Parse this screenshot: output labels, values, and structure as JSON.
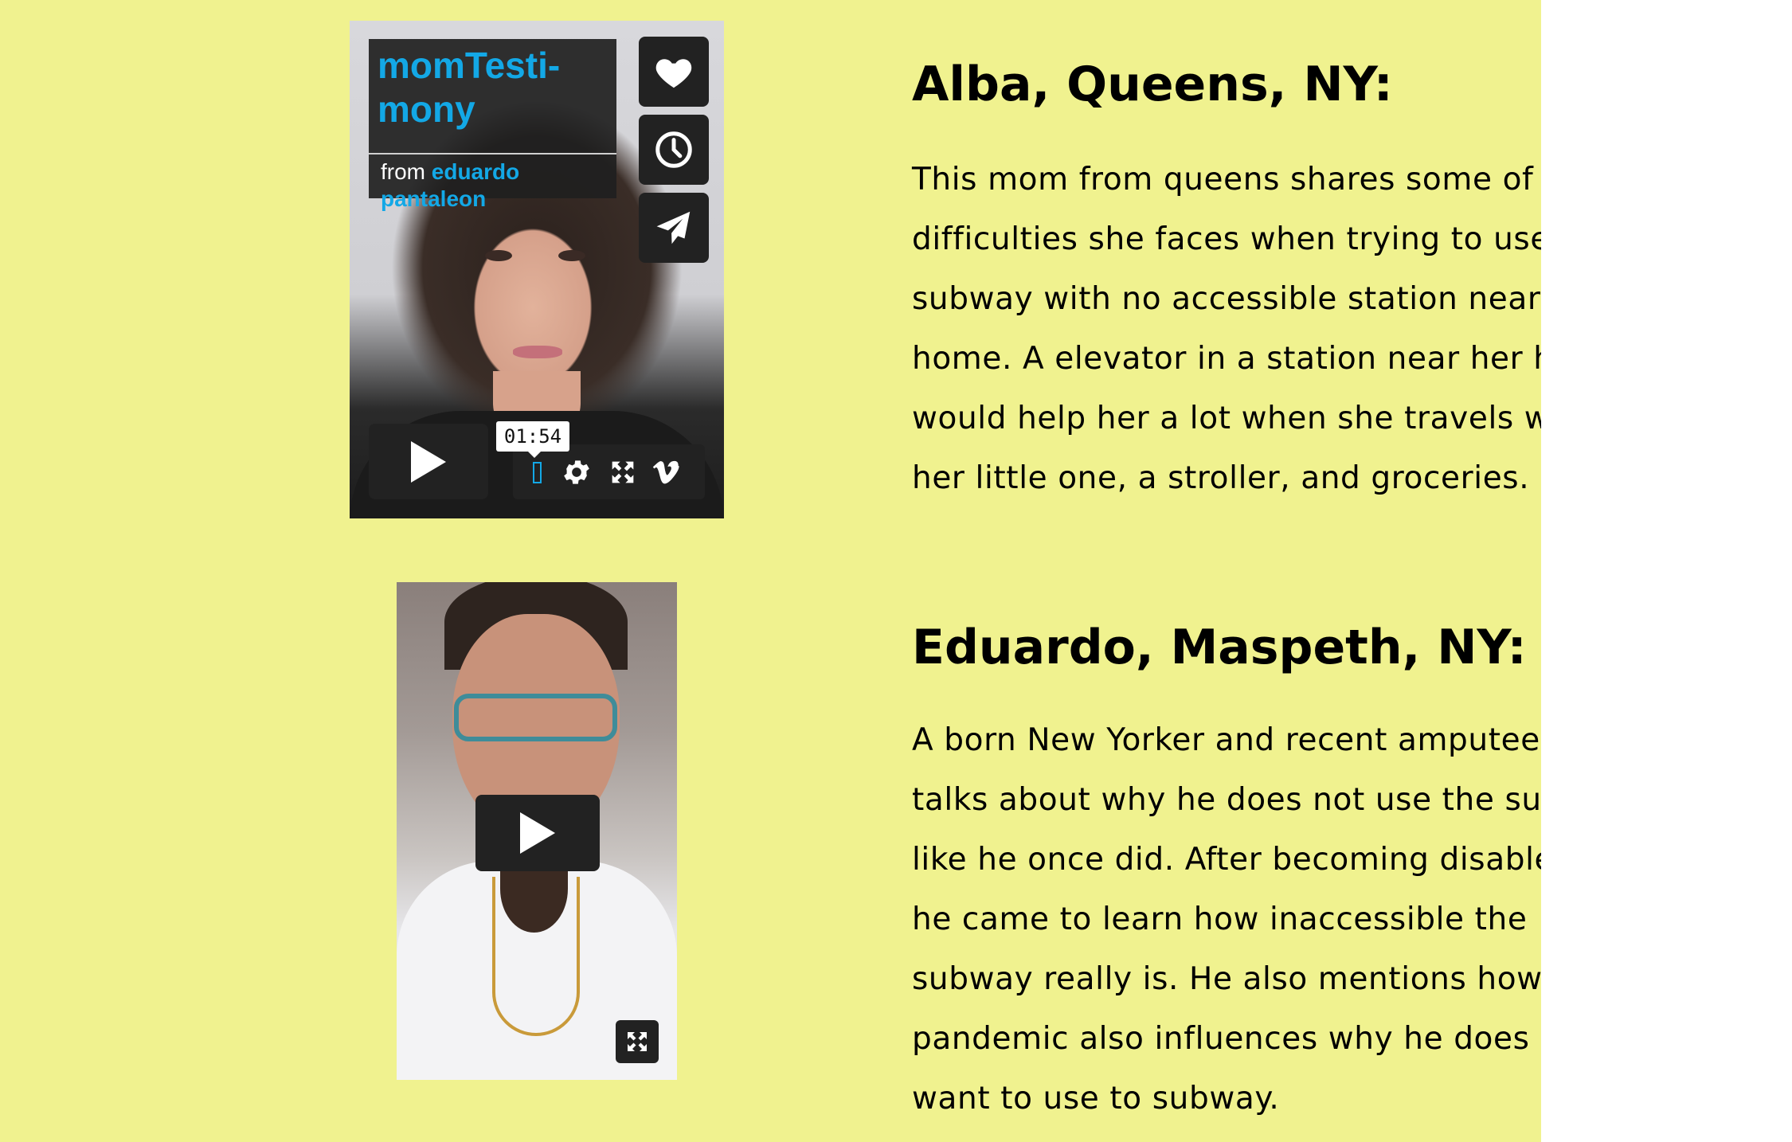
{
  "colors": {
    "page_background": "#f0f28f",
    "outside_background": "#ffffff",
    "player_accent": "#13a8e6",
    "player_control_bg": "#222222"
  },
  "videos": [
    {
      "title": "momTesti-mony",
      "byline_prefix": "from",
      "author": "eduardo pantaleon",
      "timestamp_tooltip": "01:54",
      "side_buttons": [
        "heart-icon",
        "clock-icon",
        "paper-plane-icon"
      ],
      "control_icons": [
        "play-icon",
        "settings-gear-icon",
        "fullscreen-icon",
        "vimeo-logo-icon"
      ]
    },
    {
      "control_icons": [
        "play-icon",
        "fullscreen-icon"
      ]
    }
  ],
  "testimonials": [
    {
      "heading": "Alba, Queens, NY:",
      "lines": [
        "This mom from queens shares some of the",
        "difficulties she faces when trying to use the",
        "subway with no accessible station near her",
        "home. A elevator in a station near her home",
        "would help her a lot when she travels with",
        "her little one, a stroller, and groceries."
      ]
    },
    {
      "heading": "Eduardo, Maspeth, NY:",
      "lines": [
        "A born New Yorker and recent amputee",
        "talks about why he does not use the subway",
        "like he once did. After becoming disabled,",
        "he came to learn how inaccessible the",
        "subway really is. He also mentions how the",
        "pandemic also influences why he does not",
        "want to use to subway."
      ]
    }
  ]
}
